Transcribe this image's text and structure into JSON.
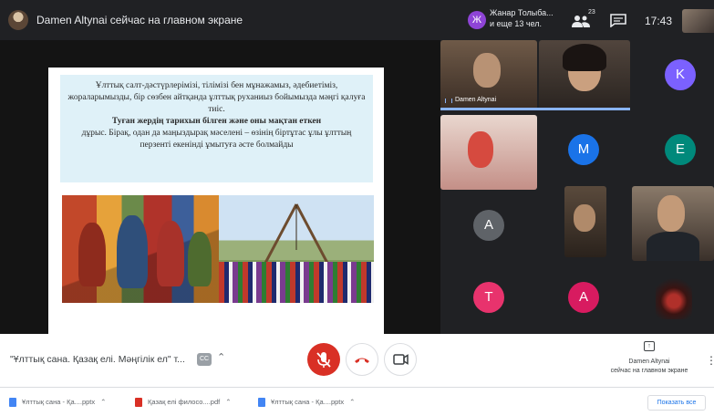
{
  "top_bar": {
    "presenter_text": "Damen Altynai сейчас на главном экране",
    "raise_hand_initial": "Ж",
    "raise_hand_name": "Жанар Толыба...",
    "raise_hand_more": "и еще 13 чел.",
    "participants_count": "23",
    "time": "17:43"
  },
  "slide": {
    "paragraph1": "Ұлттық салт-дәстүрлерімізі, тілімізі бен мұнажамыз, әдебиетіміз, жораларымызды, бір сөзбен айтқанда ұлттық руханиыз бойымызда мәңгі қалуға тиіс.",
    "paragraph2": "Туған жердің тарихын білген және оны мақтан еткен",
    "paragraph3": "дұрыс. Бірақ, одан да маңыздырақ мәселені – өзінің біртұтас ұлы ұлттың перзенті екенінді ұмытуға әсте болмайды"
  },
  "participants": {
    "speaker_name": "Damen Altynai",
    "tiles": [
      {
        "initial": "K",
        "color": "#7b61ff"
      },
      {
        "initial": "M",
        "color": "#1a73e8"
      },
      {
        "initial": "E",
        "color": "#00897b"
      },
      {
        "initial": "A",
        "color": "#5f6368"
      },
      {
        "initial": "T",
        "color": "#e8336d"
      },
      {
        "initial": "A",
        "color": "#d81b60"
      }
    ]
  },
  "controls": {
    "meeting_name": "\"Ұлттық сана. Қазақ елі. Мәңгілік ел\" т...",
    "present_label_line1": "Damen Altynai",
    "present_label_line2": "сейчас на главном экране"
  },
  "downloads": {
    "items": [
      {
        "name": "Ұлттық сана - Қа....pptx",
        "icon_color": "#4285f4"
      },
      {
        "name": "Қазақ елі филосо....pdf",
        "icon_color": "#d93025"
      },
      {
        "name": "Ұлттық сана - Қа....pptx",
        "icon_color": "#4285f4"
      }
    ],
    "show_all": "Показать все"
  }
}
